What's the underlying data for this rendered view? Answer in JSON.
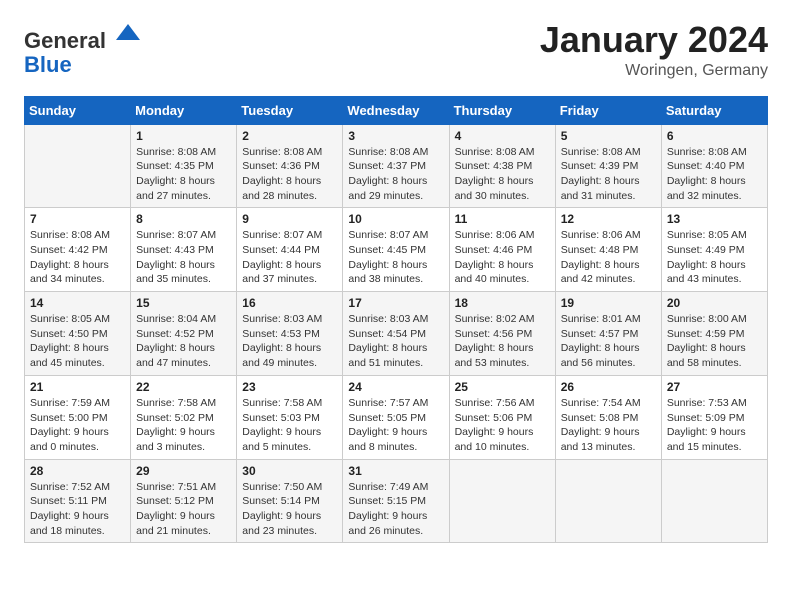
{
  "header": {
    "logo_general": "General",
    "logo_blue": "Blue",
    "month_title": "January 2024",
    "location": "Woringen, Germany"
  },
  "days_of_week": [
    "Sunday",
    "Monday",
    "Tuesday",
    "Wednesday",
    "Thursday",
    "Friday",
    "Saturday"
  ],
  "weeks": [
    [
      {
        "day": "",
        "sunrise": "",
        "sunset": "",
        "daylight": ""
      },
      {
        "day": "1",
        "sunrise": "8:08 AM",
        "sunset": "4:35 PM",
        "daylight": "8 hours and 27 minutes."
      },
      {
        "day": "2",
        "sunrise": "8:08 AM",
        "sunset": "4:36 PM",
        "daylight": "8 hours and 28 minutes."
      },
      {
        "day": "3",
        "sunrise": "8:08 AM",
        "sunset": "4:37 PM",
        "daylight": "8 hours and 29 minutes."
      },
      {
        "day": "4",
        "sunrise": "8:08 AM",
        "sunset": "4:38 PM",
        "daylight": "8 hours and 30 minutes."
      },
      {
        "day": "5",
        "sunrise": "8:08 AM",
        "sunset": "4:39 PM",
        "daylight": "8 hours and 31 minutes."
      },
      {
        "day": "6",
        "sunrise": "8:08 AM",
        "sunset": "4:40 PM",
        "daylight": "8 hours and 32 minutes."
      }
    ],
    [
      {
        "day": "7",
        "sunrise": "8:08 AM",
        "sunset": "4:42 PM",
        "daylight": "8 hours and 34 minutes."
      },
      {
        "day": "8",
        "sunrise": "8:07 AM",
        "sunset": "4:43 PM",
        "daylight": "8 hours and 35 minutes."
      },
      {
        "day": "9",
        "sunrise": "8:07 AM",
        "sunset": "4:44 PM",
        "daylight": "8 hours and 37 minutes."
      },
      {
        "day": "10",
        "sunrise": "8:07 AM",
        "sunset": "4:45 PM",
        "daylight": "8 hours and 38 minutes."
      },
      {
        "day": "11",
        "sunrise": "8:06 AM",
        "sunset": "4:46 PM",
        "daylight": "8 hours and 40 minutes."
      },
      {
        "day": "12",
        "sunrise": "8:06 AM",
        "sunset": "4:48 PM",
        "daylight": "8 hours and 42 minutes."
      },
      {
        "day": "13",
        "sunrise": "8:05 AM",
        "sunset": "4:49 PM",
        "daylight": "8 hours and 43 minutes."
      }
    ],
    [
      {
        "day": "14",
        "sunrise": "8:05 AM",
        "sunset": "4:50 PM",
        "daylight": "8 hours and 45 minutes."
      },
      {
        "day": "15",
        "sunrise": "8:04 AM",
        "sunset": "4:52 PM",
        "daylight": "8 hours and 47 minutes."
      },
      {
        "day": "16",
        "sunrise": "8:03 AM",
        "sunset": "4:53 PM",
        "daylight": "8 hours and 49 minutes."
      },
      {
        "day": "17",
        "sunrise": "8:03 AM",
        "sunset": "4:54 PM",
        "daylight": "8 hours and 51 minutes."
      },
      {
        "day": "18",
        "sunrise": "8:02 AM",
        "sunset": "4:56 PM",
        "daylight": "8 hours and 53 minutes."
      },
      {
        "day": "19",
        "sunrise": "8:01 AM",
        "sunset": "4:57 PM",
        "daylight": "8 hours and 56 minutes."
      },
      {
        "day": "20",
        "sunrise": "8:00 AM",
        "sunset": "4:59 PM",
        "daylight": "8 hours and 58 minutes."
      }
    ],
    [
      {
        "day": "21",
        "sunrise": "7:59 AM",
        "sunset": "5:00 PM",
        "daylight": "9 hours and 0 minutes."
      },
      {
        "day": "22",
        "sunrise": "7:58 AM",
        "sunset": "5:02 PM",
        "daylight": "9 hours and 3 minutes."
      },
      {
        "day": "23",
        "sunrise": "7:58 AM",
        "sunset": "5:03 PM",
        "daylight": "9 hours and 5 minutes."
      },
      {
        "day": "24",
        "sunrise": "7:57 AM",
        "sunset": "5:05 PM",
        "daylight": "9 hours and 8 minutes."
      },
      {
        "day": "25",
        "sunrise": "7:56 AM",
        "sunset": "5:06 PM",
        "daylight": "9 hours and 10 minutes."
      },
      {
        "day": "26",
        "sunrise": "7:54 AM",
        "sunset": "5:08 PM",
        "daylight": "9 hours and 13 minutes."
      },
      {
        "day": "27",
        "sunrise": "7:53 AM",
        "sunset": "5:09 PM",
        "daylight": "9 hours and 15 minutes."
      }
    ],
    [
      {
        "day": "28",
        "sunrise": "7:52 AM",
        "sunset": "5:11 PM",
        "daylight": "9 hours and 18 minutes."
      },
      {
        "day": "29",
        "sunrise": "7:51 AM",
        "sunset": "5:12 PM",
        "daylight": "9 hours and 21 minutes."
      },
      {
        "day": "30",
        "sunrise": "7:50 AM",
        "sunset": "5:14 PM",
        "daylight": "9 hours and 23 minutes."
      },
      {
        "day": "31",
        "sunrise": "7:49 AM",
        "sunset": "5:15 PM",
        "daylight": "9 hours and 26 minutes."
      },
      {
        "day": "",
        "sunrise": "",
        "sunset": "",
        "daylight": ""
      },
      {
        "day": "",
        "sunrise": "",
        "sunset": "",
        "daylight": ""
      },
      {
        "day": "",
        "sunrise": "",
        "sunset": "",
        "daylight": ""
      }
    ]
  ],
  "labels": {
    "sunrise_prefix": "Sunrise: ",
    "sunset_prefix": "Sunset: ",
    "daylight_prefix": "Daylight: "
  }
}
